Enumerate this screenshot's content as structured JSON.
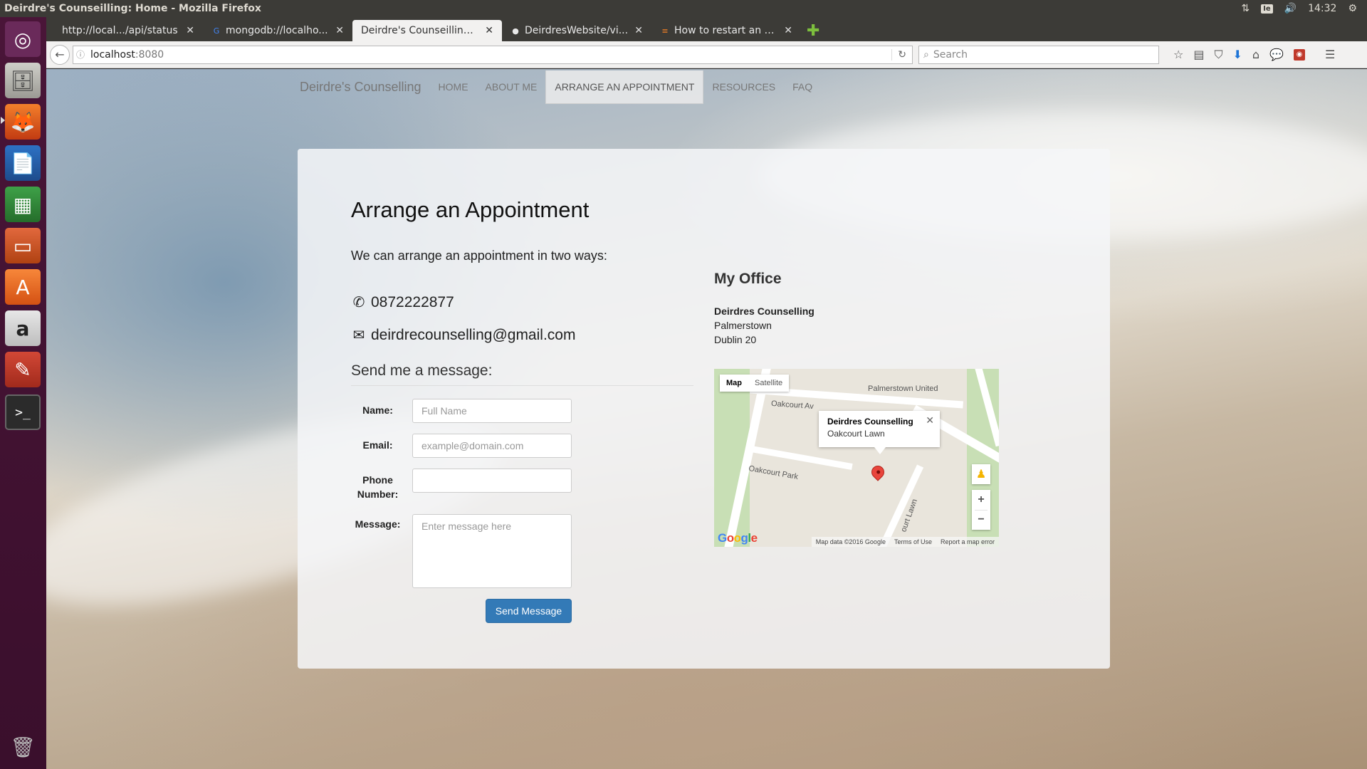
{
  "window": {
    "title": "Deirdre's Counseilling: Home - Mozilla Firefox",
    "clock": "14:32",
    "keyboard": "Ie"
  },
  "launcher": {
    "items": [
      "ubuntu-logo",
      "files",
      "firefox",
      "writer",
      "calc",
      "impress",
      "software-center",
      "amazon",
      "system-settings",
      "terminal",
      "trash"
    ],
    "amazon_glyph": "a",
    "terminal_glyph": ">_"
  },
  "tabs": [
    {
      "label": "http://local.../api/status",
      "active": false
    },
    {
      "label": "mongodb://localho...",
      "active": false
    },
    {
      "label": "Deirdre's Counseilling: ...",
      "active": true
    },
    {
      "label": "DeirdresWebsite/vi...",
      "active": false
    },
    {
      "label": "How to restart an e...",
      "active": false
    }
  ],
  "urlbar": {
    "host": "localhost",
    "port": ":8080"
  },
  "searchbar": {
    "placeholder": "Search"
  },
  "site": {
    "brand": "Deirdre's Counselling",
    "nav": [
      {
        "label": "HOME",
        "active": false
      },
      {
        "label": "ABOUT ME",
        "active": false
      },
      {
        "label": "ARRANGE AN APPOINTMENT",
        "active": true
      },
      {
        "label": "RESOURCES",
        "active": false
      },
      {
        "label": "FAQ",
        "active": false
      }
    ]
  },
  "main": {
    "heading": "Arrange an Appointment",
    "intro": "We can arrange an appointment in two ways:",
    "phone": "0872222877",
    "email": "deirdrecounselling@gmail.com",
    "message_heading": "Send me a message:"
  },
  "form": {
    "name_label": "Name:",
    "name_placeholder": "Full Name",
    "email_label": "Email:",
    "email_placeholder": "example@domain.com",
    "phone_label": "Phone Number:",
    "phone_value": "",
    "message_label": "Message:",
    "message_placeholder": "Enter message here",
    "submit_label": "Send Message",
    "submit_color": "#337ab7"
  },
  "office": {
    "heading": "My Office",
    "name": "Deirdres Counselling",
    "line1": "Palmerstown",
    "line2": "Dublin 20"
  },
  "map": {
    "type_map": "Map",
    "type_satellite": "Satellite",
    "info_title": "Deirdres Counselling",
    "info_subtitle": "Oakcourt Lawn",
    "label_palmerstown": "Palmerstown United",
    "label_oakcourt_ave": "Oakcourt Av",
    "label_oakcourt_park": "Oakcourt Park",
    "label_oakcourt_lawn": "ourt Lawn",
    "footer_data": "Map data ©2016 Google",
    "footer_terms": "Terms of Use",
    "footer_report": "Report a map error",
    "logo": "Google"
  }
}
